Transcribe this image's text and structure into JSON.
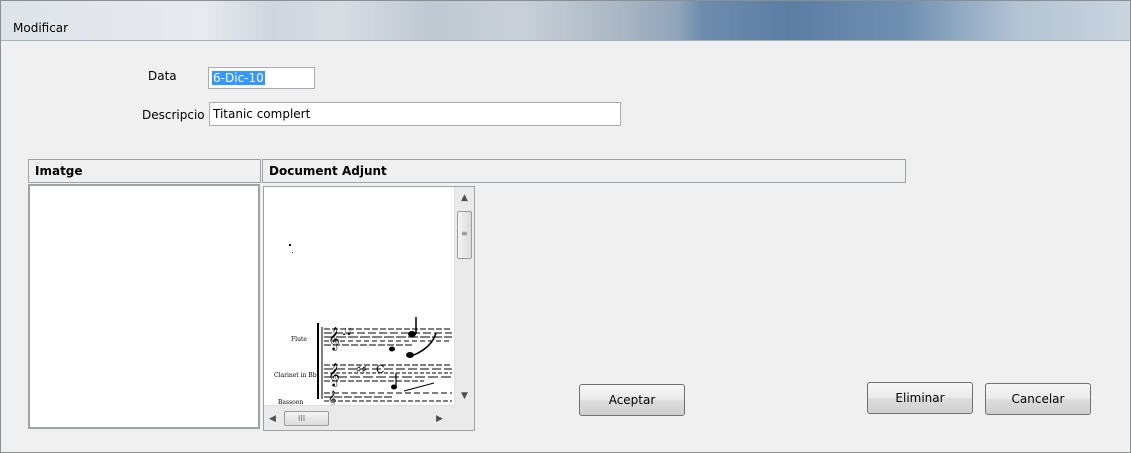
{
  "window": {
    "title": "Modificar"
  },
  "form": {
    "data_label": "Data",
    "data_value": "6-Dic-10",
    "descripcio_label": "Descripcio",
    "descripcio_value": "Titanic complert"
  },
  "panels": {
    "imatge_header": "Imatge",
    "document_header": "Document Adjunt"
  },
  "document_preview": {
    "staff_labels": [
      "Flute",
      "Clarinet in Bb",
      "Bassoon"
    ]
  },
  "scrollbar": {
    "h_thumb_label": "III"
  },
  "buttons": {
    "aceptar": "Aceptar",
    "eliminar": "Eliminar",
    "cancelar": "Cancelar"
  }
}
